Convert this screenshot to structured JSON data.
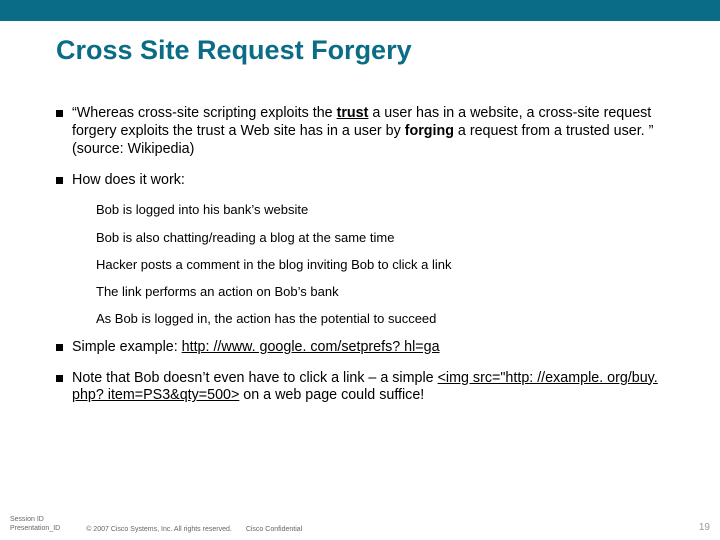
{
  "title": "Cross Site Request Forgery",
  "bullets": [
    {
      "pre": "“Whereas cross-site scripting exploits the ",
      "b1": "trust",
      "mid": " a user has in a website, a cross-site request forgery exploits the trust a Web site has in a user by ",
      "b2": "forging",
      "post": " a request from a trusted user. ” (source: Wikipedia)"
    },
    {
      "text": "How does it work:"
    },
    {
      "text": "Simple example: ",
      "link": "http: //www. google. com/setprefs? hl=ga"
    },
    {
      "pre": "Note that Bob doesn’t even have to click a link – a simple ",
      "link": "<img src=\"http: //example. org/buy. php? item=PS3&qty=500>",
      "post": " on a web page could suffice!"
    }
  ],
  "subs": [
    "Bob is logged into his bank’s website",
    "Bob is also chatting/reading a blog at the same time",
    "Hacker posts a comment in the blog inviting Bob to click a link",
    "The link performs an action on Bob’s bank",
    "As Bob is logged in, the action has the potential to succeed"
  ],
  "footer": {
    "session_l1": "Session ID",
    "session_l2": "Presentation_ID",
    "copyright": "© 2007 Cisco Systems, Inc. All rights reserved.",
    "conf": "Cisco Confidential",
    "page": "19"
  }
}
